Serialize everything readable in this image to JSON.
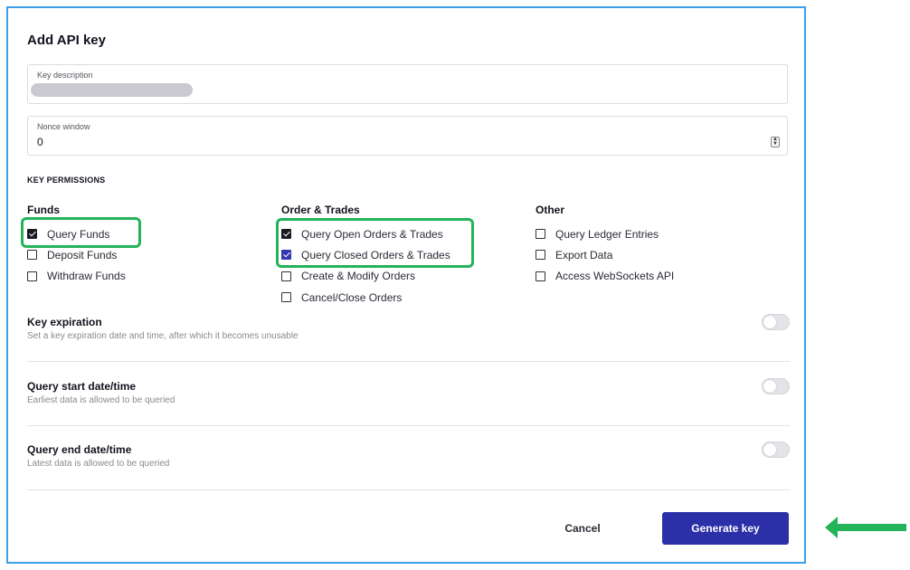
{
  "dialog": {
    "title": "Add API key",
    "key_description": {
      "label": "Key description",
      "value": ""
    },
    "nonce_window": {
      "label": "Nonce window",
      "value": "0"
    },
    "permissions_heading": "KEY PERMISSIONS",
    "columns": [
      {
        "title": "Funds",
        "items": [
          {
            "label": "Query Funds",
            "checked": true
          },
          {
            "label": "Deposit Funds",
            "checked": false
          },
          {
            "label": "Withdraw Funds",
            "checked": false
          }
        ]
      },
      {
        "title": "Order & Trades",
        "items": [
          {
            "label": "Query Open Orders & Trades",
            "checked": true
          },
          {
            "label": "Query Closed Orders & Trades",
            "checked": true
          },
          {
            "label": "Create & Modify Orders",
            "checked": false
          },
          {
            "label": "Cancel/Close Orders",
            "checked": false
          }
        ]
      },
      {
        "title": "Other",
        "items": [
          {
            "label": "Query Ledger Entries",
            "checked": false
          },
          {
            "label": "Export Data",
            "checked": false
          },
          {
            "label": "Access WebSockets API",
            "checked": false
          }
        ]
      }
    ],
    "options": [
      {
        "title": "Key expiration",
        "subtitle": "Set a key expiration date and time, after which it becomes unusable",
        "enabled": false
      },
      {
        "title": "Query start date/time",
        "subtitle": "Earliest data is allowed to be queried",
        "enabled": false
      },
      {
        "title": "Query end date/time",
        "subtitle": "Latest data is allowed to be queried",
        "enabled": false
      }
    ],
    "cancel_label": "Cancel",
    "generate_label": "Generate key"
  },
  "colors": {
    "panel_border": "#3b9ee6",
    "primary_button": "#2b2fa8",
    "highlight": "#23b45a",
    "checkbox_checked_blue": "#3538b0"
  },
  "annotations": {
    "highlight_boxes": [
      "Query Funds",
      "Query Open Orders & Trades + Query Closed Orders & Trades"
    ],
    "arrow_icon": "left-arrow-icon"
  }
}
